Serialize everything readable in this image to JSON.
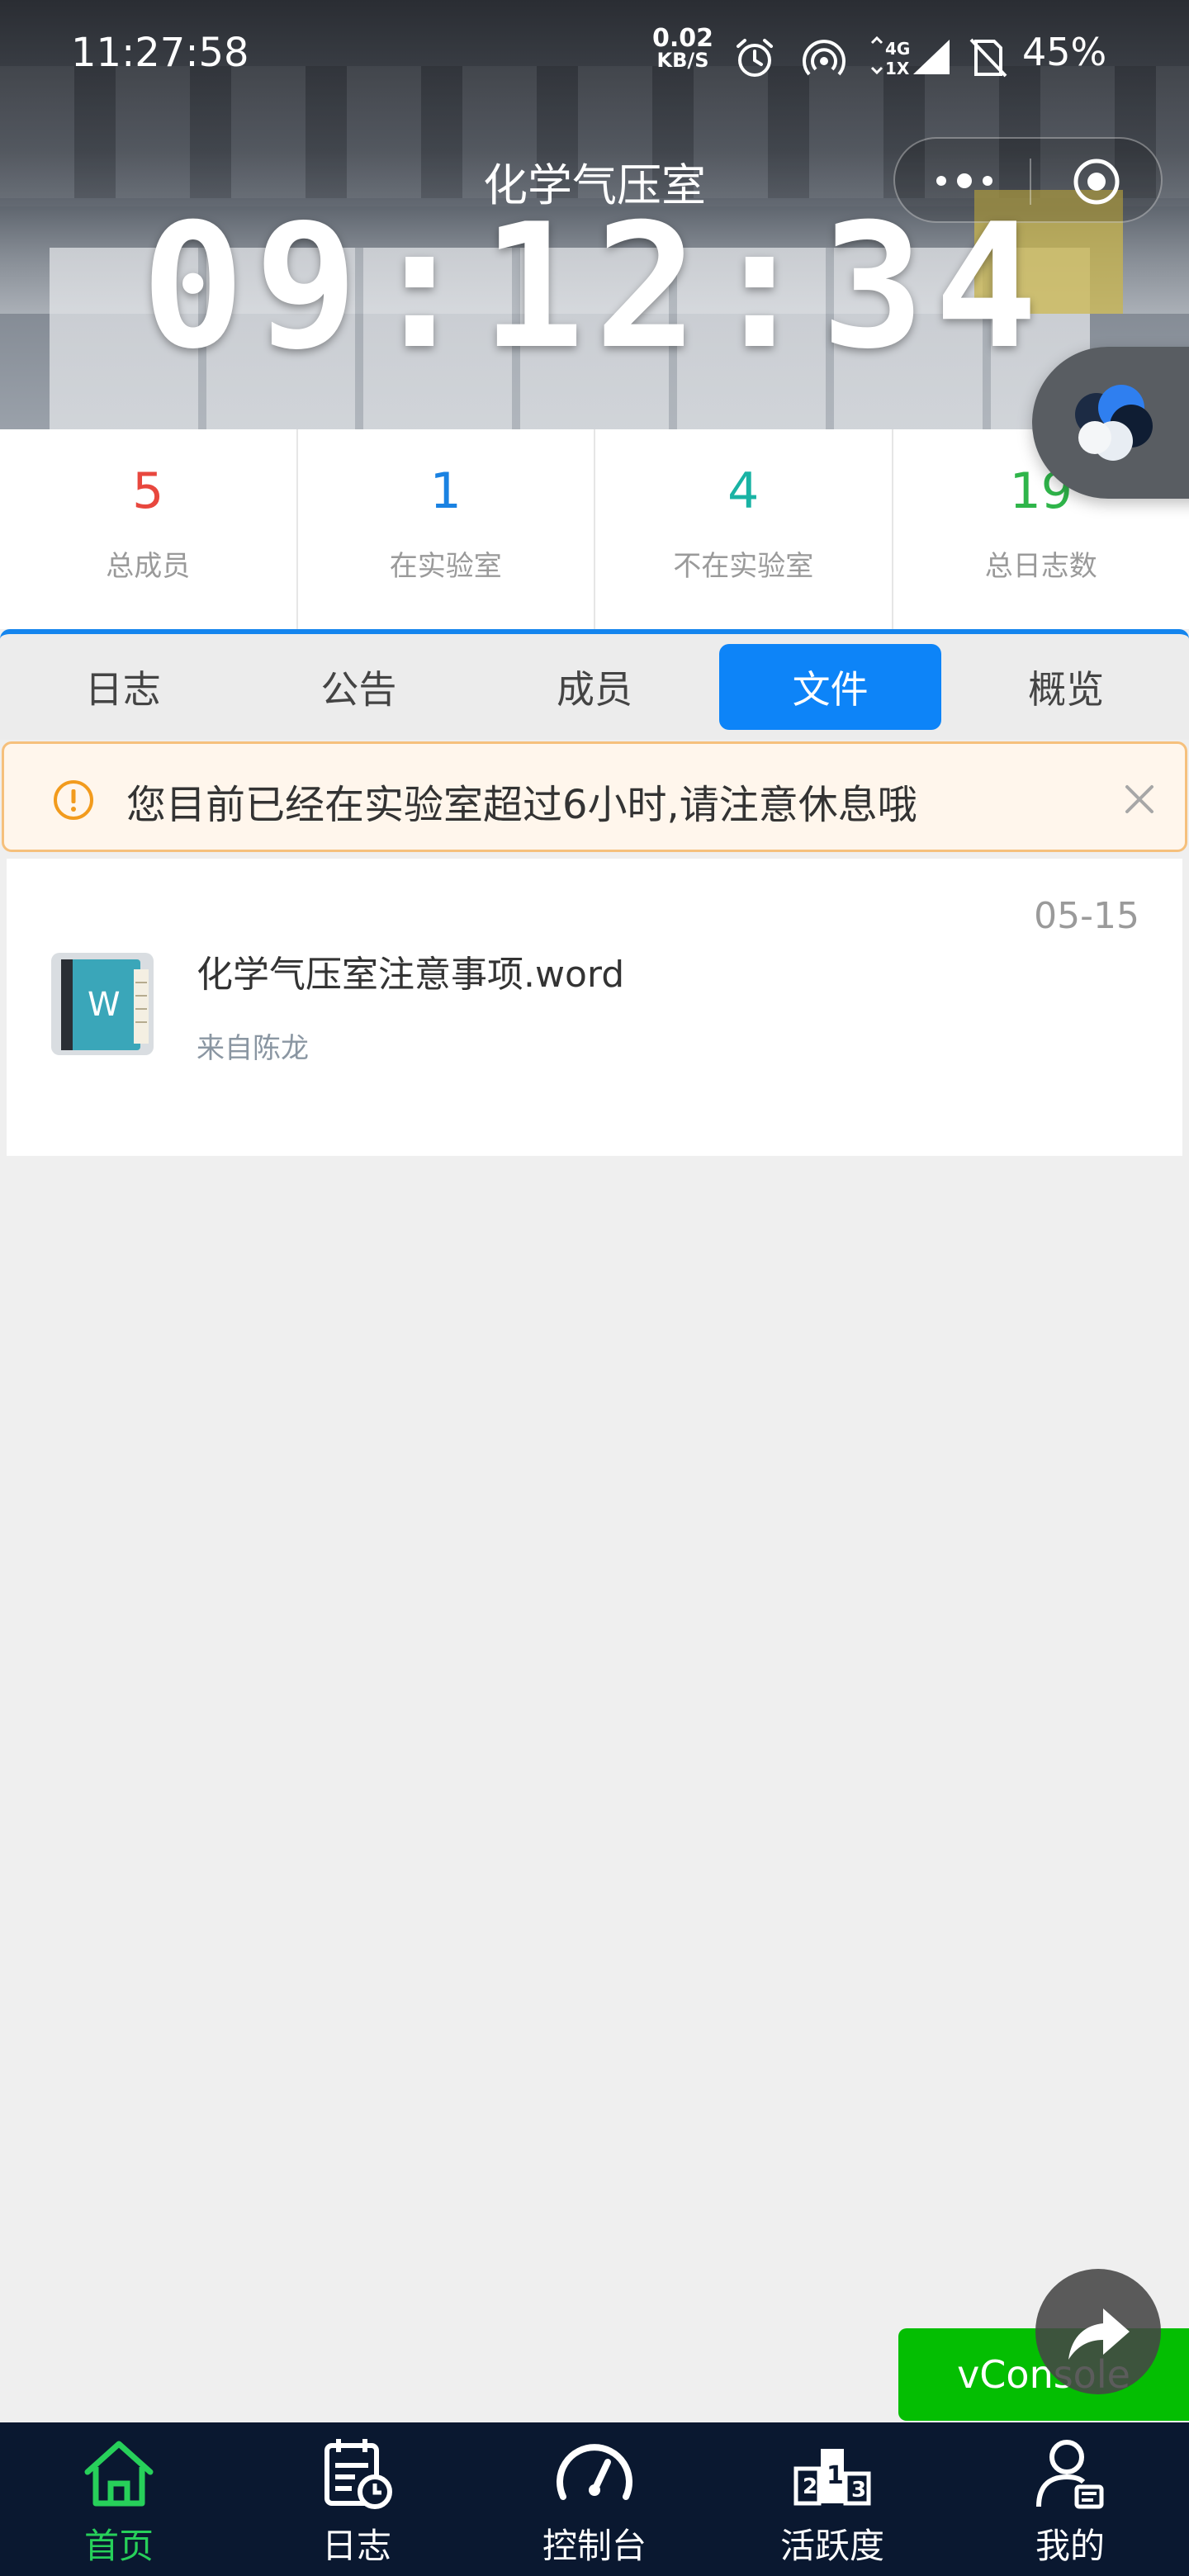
{
  "status_bar": {
    "time": "11:27:58",
    "net_speed": "0.02",
    "net_unit": "KB/S",
    "battery": "45%"
  },
  "header": {
    "title": "化学气压室",
    "clock": "09:12:34"
  },
  "stats": [
    {
      "value": "5",
      "label": "总成员",
      "color": "#e8473e"
    },
    {
      "value": "1",
      "label": "在实验室",
      "color": "#1a82e2"
    },
    {
      "value": "4",
      "label": "不在实验室",
      "color": "#19b3a4"
    },
    {
      "value": "19",
      "label": "总日志数",
      "color": "#2fb54a"
    }
  ],
  "tabs": [
    {
      "label": "日志",
      "active": false
    },
    {
      "label": "公告",
      "active": false
    },
    {
      "label": "成员",
      "active": false
    },
    {
      "label": "文件",
      "active": true
    },
    {
      "label": "概览",
      "active": false
    }
  ],
  "notice": {
    "text": "您目前已经在实验室超过6小时,请注意休息哦"
  },
  "files": [
    {
      "name": "化学气压室注意事项.word",
      "from": "来自陈龙",
      "date": "05-15",
      "icon": "word-document-icon"
    }
  ],
  "vconsole": {
    "label": "vConsole"
  },
  "bottom_nav": [
    {
      "label": "首页",
      "icon": "home-icon",
      "active": true
    },
    {
      "label": "日志",
      "icon": "calendar-clock-icon",
      "active": false
    },
    {
      "label": "控制台",
      "icon": "speedometer-icon",
      "active": false
    },
    {
      "label": "活跃度",
      "icon": "podium-icon",
      "active": false
    },
    {
      "label": "我的",
      "icon": "user-icon",
      "active": false
    }
  ],
  "colors": {
    "accent": "#0d84f8",
    "nav_bg": "#0a1830",
    "nav_active": "#27d05a",
    "vconsole": "#04be02",
    "notice_border": "#f6c07c"
  }
}
